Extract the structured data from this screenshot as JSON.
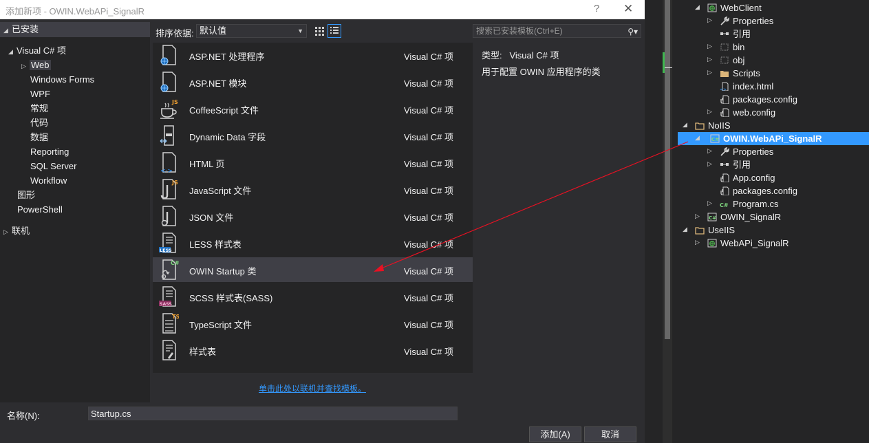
{
  "dialog": {
    "title": "添加新项 - OWIN.WebAPi_SignalR",
    "help": "?",
    "close": "✕",
    "nav": {
      "installed": "已安装",
      "visual_csharp": "Visual C# 项",
      "children": [
        "Web",
        "Windows Forms",
        "WPF",
        "常规",
        "代码",
        "数据",
        "Reporting",
        "SQL Server",
        "Workflow"
      ],
      "graphics": "图形",
      "powershell": "PowerShell",
      "online": "联机"
    },
    "toolbar": {
      "sort_label": "排序依据:",
      "sort_value": "默认值",
      "search_placeholder": "搜索已安装模板(Ctrl+E)"
    },
    "templates": [
      {
        "name": "ASP.NET 处理程序",
        "type": "Visual C# 项",
        "icon": "handler-icon"
      },
      {
        "name": "ASP.NET 模块",
        "type": "Visual C# 项",
        "icon": "module-icon"
      },
      {
        "name": "CoffeeScript 文件",
        "type": "Visual C# 项",
        "icon": "coffeescript-icon"
      },
      {
        "name": "Dynamic Data 字段",
        "type": "Visual C# 项",
        "icon": "dynamic-data-icon"
      },
      {
        "name": "HTML 页",
        "type": "Visual C# 项",
        "icon": "html-icon"
      },
      {
        "name": "JavaScript 文件",
        "type": "Visual C# 项",
        "icon": "javascript-icon"
      },
      {
        "name": "JSON 文件",
        "type": "Visual C# 项",
        "icon": "json-icon"
      },
      {
        "name": "LESS 样式表",
        "type": "Visual C# 项",
        "icon": "less-icon"
      },
      {
        "name": "OWIN Startup 类",
        "type": "Visual C# 项",
        "icon": "owin-startup-icon"
      },
      {
        "name": "SCSS 样式表(SASS)",
        "type": "Visual C# 项",
        "icon": "scss-icon"
      },
      {
        "name": "TypeScript 文件",
        "type": "Visual C# 项",
        "icon": "typescript-icon"
      },
      {
        "name": "样式表",
        "type": "Visual C# 项",
        "icon": "stylesheet-icon"
      }
    ],
    "detail": {
      "type_label": "类型:",
      "type_value": "Visual C# 项",
      "description": "用于配置 OWIN 应用程序的类"
    },
    "online_link": "单击此处以联机并查找模板。",
    "name_label": "名称(N):",
    "name_value": "Startup.cs",
    "add_button": "添加(A)",
    "cancel_button": "取消"
  },
  "solution_explorer": {
    "items": [
      {
        "label": "WebClient",
        "icon": "web-project-icon",
        "expand": "expanded"
      },
      {
        "label": "Properties",
        "icon": "wrench-icon",
        "expand": "collapsed"
      },
      {
        "label": "引用",
        "icon": "references-icon",
        "expand": "none"
      },
      {
        "label": "bin",
        "icon": "dotted-folder-icon",
        "expand": "collapsed"
      },
      {
        "label": "obj",
        "icon": "dotted-folder-icon",
        "expand": "collapsed"
      },
      {
        "label": "Scripts",
        "icon": "folder-icon",
        "expand": "collapsed"
      },
      {
        "label": "index.html",
        "icon": "html-file-icon",
        "expand": "none"
      },
      {
        "label": "packages.config",
        "icon": "config-icon",
        "expand": "none"
      },
      {
        "label": "web.config",
        "icon": "config-icon",
        "expand": "collapsed"
      },
      {
        "label": "NoIIS",
        "icon": "solution-folder-icon",
        "expand": "expanded"
      },
      {
        "label": "OWIN.WebAPi_SignalR",
        "icon": "csharp-project-icon",
        "expand": "expanded",
        "selected": true
      },
      {
        "label": "Properties",
        "icon": "wrench-icon",
        "expand": "collapsed"
      },
      {
        "label": "引用",
        "icon": "references-icon",
        "expand": "collapsed"
      },
      {
        "label": "App.config",
        "icon": "config-icon",
        "expand": "none"
      },
      {
        "label": "packages.config",
        "icon": "config-icon",
        "expand": "none"
      },
      {
        "label": "Program.cs",
        "icon": "csharp-file-icon",
        "expand": "collapsed"
      },
      {
        "label": "OWIN_SignalR",
        "icon": "csharp-project-icon",
        "expand": "collapsed"
      },
      {
        "label": "UseIIS",
        "icon": "solution-folder-icon",
        "expand": "expanded"
      },
      {
        "label": "WebAPi_SignalR",
        "icon": "web-project-icon",
        "expand": "collapsed"
      }
    ]
  },
  "colors": {
    "dialog_bg": "#2d2d30",
    "panel_bg": "#252526",
    "selection": "#3f3f46",
    "accent": "#3399ff",
    "annotation_arrow": "#e81123"
  }
}
